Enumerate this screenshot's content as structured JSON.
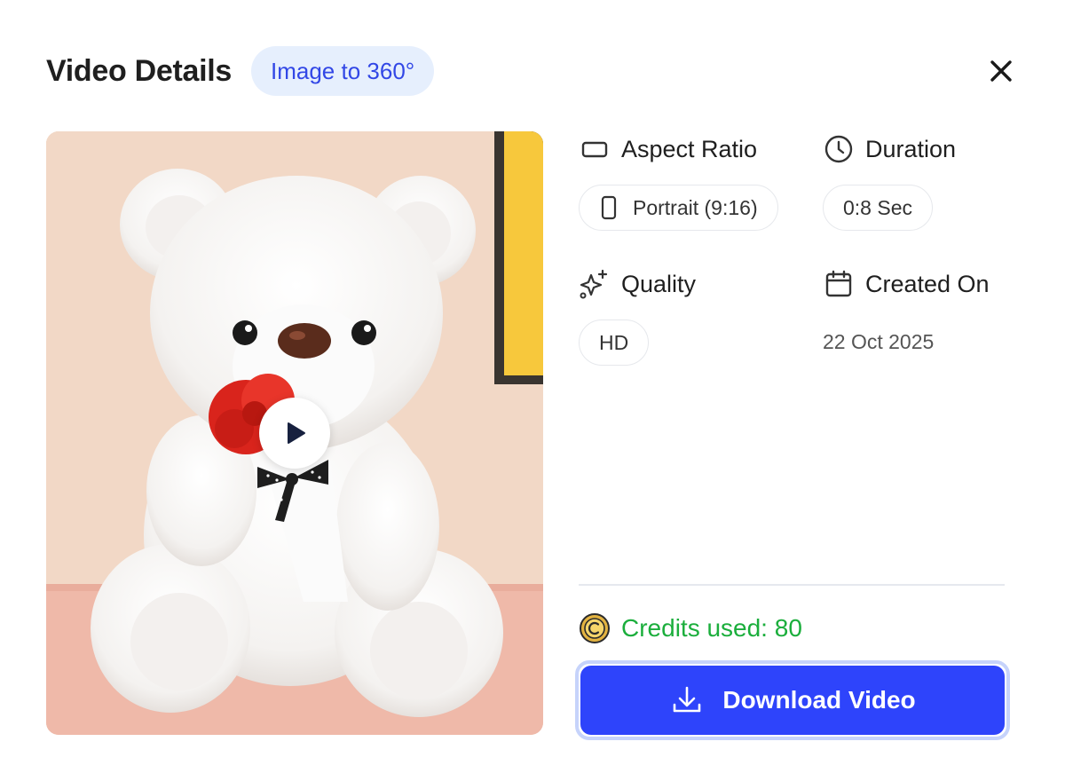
{
  "header": {
    "title": "Video Details",
    "type_badge": "Image to 360°"
  },
  "preview": {
    "subject": "white teddy bear holding red rose",
    "play_icon": "play-icon"
  },
  "details": {
    "aspect_ratio": {
      "label": "Aspect Ratio",
      "icon": "rectangle-icon",
      "value": "Portrait (9:16)",
      "value_icon": "portrait-phone-icon"
    },
    "duration": {
      "label": "Duration",
      "icon": "clock-icon",
      "value": "0:8 Sec"
    },
    "quality": {
      "label": "Quality",
      "icon": "sparkles-icon",
      "value": "HD"
    },
    "created_on": {
      "label": "Created On",
      "icon": "calendar-icon",
      "value": "22 Oct 2025"
    }
  },
  "credits": {
    "text": "Credits used: 80",
    "icon": "coin-icon"
  },
  "download": {
    "label": "Download Video",
    "icon": "download-icon"
  },
  "colors": {
    "accent": "#2e44fb",
    "badge_bg": "#e6effd",
    "badge_text": "#3247e6",
    "credits_green": "#1bae3c"
  }
}
